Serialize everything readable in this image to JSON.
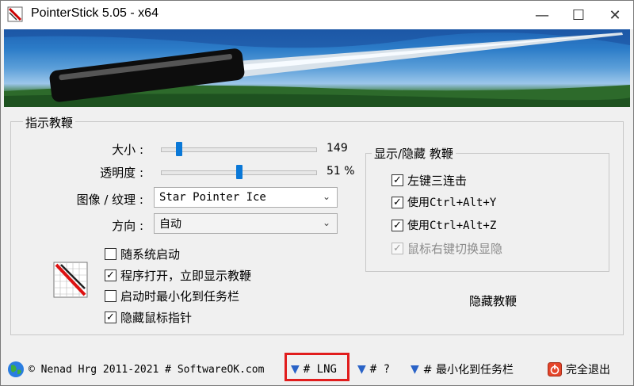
{
  "window": {
    "title": "PointerStick 5.05 - x64",
    "controls": {
      "minimize": "—",
      "maximize": "☐",
      "close": "✕"
    }
  },
  "pointer_group": {
    "legend": "指示教鞭",
    "size": {
      "label": "大小 :",
      "value": "149",
      "level": 0.12
    },
    "opacity": {
      "label": "透明度 :",
      "value": "51 %",
      "level": 0.51
    },
    "image": {
      "label": "图像 / 纹理 :",
      "selected": "Star Pointer Ice"
    },
    "direction": {
      "label": "方向 :",
      "selected": "自动"
    },
    "checkboxes": [
      {
        "label": "随系统启动",
        "checked": false
      },
      {
        "label": "程序打开，立即显示教鞭",
        "checked": true
      },
      {
        "label": "启动时最小化到任务栏",
        "checked": false
      },
      {
        "label": "隐藏鼠标指针",
        "checked": true
      }
    ]
  },
  "toggle_group": {
    "legend": "显示/隐藏 教鞭",
    "checkboxes": [
      {
        "label": "左键三连击",
        "checked": true,
        "disabled": false
      },
      {
        "label": "使用Ctrl+Alt+Y",
        "checked": true,
        "disabled": false
      },
      {
        "label": "使用Ctrl+Alt+Z",
        "checked": true,
        "disabled": false
      },
      {
        "label": "鼠标右键切换显隐",
        "checked": true,
        "disabled": true
      }
    ],
    "hide_button": "隐藏教鞭"
  },
  "statusbar": {
    "copyright": "© Nenad Hrg 2011-2021 # SoftwareOK.com",
    "lng": "# LNG",
    "help": "# ?",
    "minimize": "# 最小化到任务栏",
    "exit": "完全退出"
  },
  "colors": {
    "accent": "#0a78d7",
    "highlight": "#e11d1d"
  },
  "icons": [
    "pointerstick-app-icon",
    "pointer-preview-icon",
    "globe-icon",
    "filter-menu-icon",
    "exit-icon"
  ]
}
